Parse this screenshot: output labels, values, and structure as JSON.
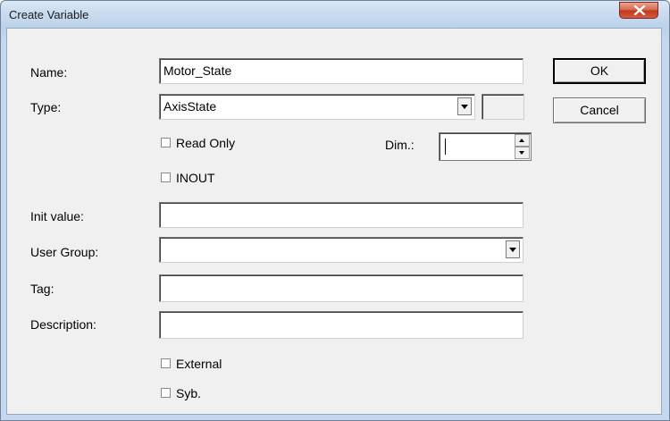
{
  "window": {
    "title": "Create Variable"
  },
  "form": {
    "name_label": "Name:",
    "name_value": "Motor_State",
    "type_label": "Type:",
    "type_value": "AxisState",
    "read_only_label": "Read Only",
    "dim_label": "Dim.:",
    "dim_value": "",
    "inout_label": "INOUT",
    "init_value_label": "Init value:",
    "init_value": "",
    "user_group_label": "User Group:",
    "user_group_value": "",
    "tag_label": "Tag:",
    "tag_value": "",
    "description_label": "Description:",
    "description_value": "",
    "external_label": "External",
    "syb_label": "Syb."
  },
  "buttons": {
    "ok_label": "OK",
    "cancel_label": "Cancel"
  },
  "checkbox_states": {
    "read_only": false,
    "inout": false,
    "external": false,
    "syb": false
  }
}
